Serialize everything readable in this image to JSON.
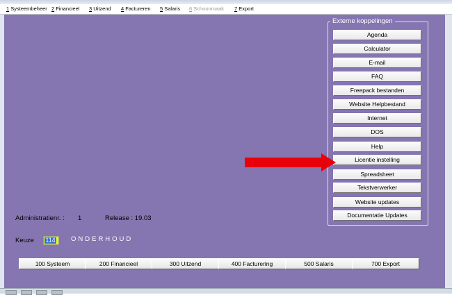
{
  "menu": [
    {
      "num": "1",
      "label": " Systeembeheer",
      "disabled": false
    },
    {
      "num": "2",
      "label": " Financieel",
      "disabled": false
    },
    {
      "num": "3",
      "label": " Uitzend",
      "disabled": false
    },
    {
      "num": "4",
      "label": " Factureren",
      "disabled": false
    },
    {
      "num": "5",
      "label": " Salaris",
      "disabled": false
    },
    {
      "num": "6",
      "label": " Schoonmaak",
      "disabled": true
    },
    {
      "num": "7",
      "label": " Export",
      "disabled": false
    }
  ],
  "external": {
    "title": "Externe koppelingen",
    "buttons": [
      "Agenda",
      "Calculator",
      "E-mail",
      "FAQ",
      "Freepack bestanden",
      "Website Helpbestand",
      "Internet",
      "DOS",
      "Help",
      "Licentie instelling",
      "Spreadsheet",
      "Tekstverwerker",
      "Website updates",
      "Documentatie Updates"
    ]
  },
  "info": {
    "admin_label": "Administratienr. :",
    "admin_value": "1",
    "release_label": "Release : 19.03"
  },
  "keuze": {
    "label": "Keuze",
    "value": "114",
    "mode": "ONDERHOUD"
  },
  "bottom_buttons": [
    "100 Systeem",
    "200 Financieel",
    "300 Uitzend",
    "400 Facturering",
    "500 Salaris",
    "700 Export"
  ],
  "colors": {
    "background": "#8575b1",
    "arrow": "#e8000b",
    "input_bg": "#ffff00",
    "input_highlight": "#2f6ed6"
  }
}
